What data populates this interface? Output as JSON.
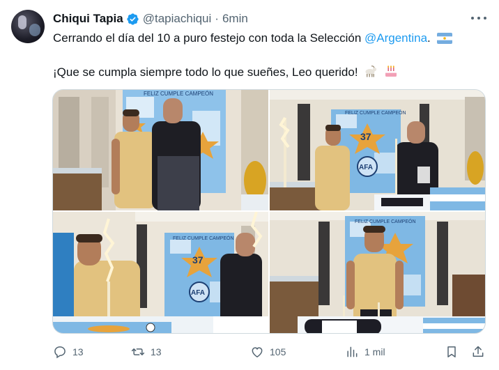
{
  "author": {
    "name": "Chiqui Tapia",
    "handle": "@tapiachiqui",
    "separator": "·",
    "time": "6min"
  },
  "tweet": {
    "line1_text": "Cerrando el día del 10 a puro festejo con toda la Selección ",
    "line1_mention": "@Argentina",
    "line1_end": ".",
    "line2_text": "¡Que se cumpla siempre todo lo que sueñes, Leo querido!",
    "emojis": [
      "argentina-flag-emoji",
      "goat-emoji",
      "birthday-cake-emoji"
    ]
  },
  "photos": {
    "banner_text": "FELIZ CUMPLE CAMPEÓN",
    "number": "37",
    "crest_text": "AFA"
  },
  "actions": {
    "replies": "13",
    "retweets": "13",
    "likes": "105",
    "views": "1 mil"
  },
  "colors": {
    "accent": "#1d9bf0",
    "muted": "#536471",
    "text": "#0f1419",
    "jersey": "#e2c27f",
    "mural_blue": "#7fb8e4",
    "star_gold": "#e7a33c"
  }
}
